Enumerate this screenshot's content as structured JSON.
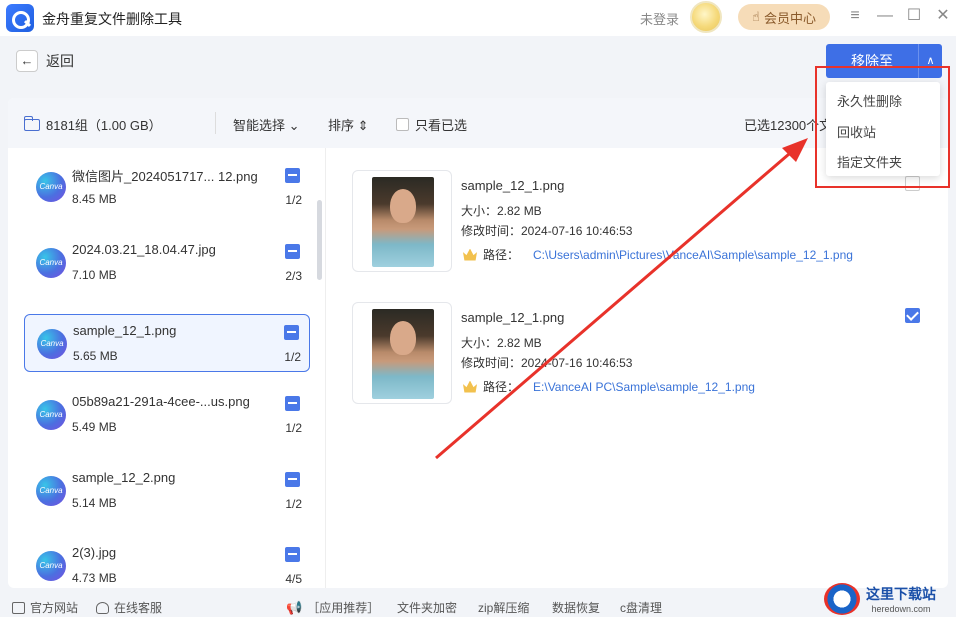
{
  "titlebar": {
    "app_title": "金舟重复文件删除工具",
    "login_text": "未登录",
    "vip_label": "会员中心",
    "menu_icon": "≡",
    "minimize_icon": "—",
    "maximize_icon": "☐",
    "close_icon": "✕"
  },
  "toolbar": {
    "back_label": "返回",
    "back_icon": "←",
    "move_label": "移除至",
    "move_caret": "∧"
  },
  "dropdown": {
    "items": [
      "永久性删除",
      "回收站",
      "指定文件夹"
    ]
  },
  "filterbar": {
    "group_info": "8181组（1.00 GB）",
    "smart_select": "智能选择 ⌄",
    "sort": "排序 ⇕",
    "only_selected": "只看已选",
    "selected_count": "已选12300个文"
  },
  "file_list": [
    {
      "name": "微信图片_2024051717... 12.png",
      "size": "8.45 MB",
      "count": "1/2"
    },
    {
      "name": "2024.03.21_18.04.47.jpg",
      "size": "7.10 MB",
      "count": "2/3"
    },
    {
      "name": "sample_12_1.png",
      "size": "5.65 MB",
      "count": "1/2"
    },
    {
      "name": "05b89a21-291a-4cee-...us.png",
      "size": "5.49 MB",
      "count": "1/2"
    },
    {
      "name": "sample_12_2.png",
      "size": "5.14 MB",
      "count": "1/2"
    },
    {
      "name": "2(3).jpg",
      "size": "4.73 MB",
      "count": "4/5"
    }
  ],
  "icon_text": {
    "canva": "Canva"
  },
  "details": [
    {
      "name": "sample_12_1.png",
      "size": "大小：2.82 MB",
      "time": "修改时间：2024-07-16 10:46:53",
      "path_label": "路径：",
      "path": "C:\\Users\\admin\\Pictures\\VanceAI\\Sample\\sample_12_1.png",
      "checked": false
    },
    {
      "name": "sample_12_1.png",
      "size": "大小：2.82 MB",
      "time": "修改时间：2024-07-16 10:46:53",
      "path_label": "路径：",
      "path": "E:\\VanceAI PC\\Sample\\sample_12_1.png",
      "checked": true
    }
  ],
  "footer": {
    "website": "官方网站",
    "service": "在线客服",
    "recommend": "［应用推荐］",
    "links": [
      "文件夹加密",
      "zip解压缩",
      "数据恢复",
      "c盘清理"
    ]
  },
  "watermark": {
    "cn": "这里下载站",
    "url": "heredown.com",
    "logo_letter": "Z"
  },
  "colors": {
    "accent": "#3e6fe6",
    "highlight": "#e8322a",
    "link": "#3a73d8"
  }
}
